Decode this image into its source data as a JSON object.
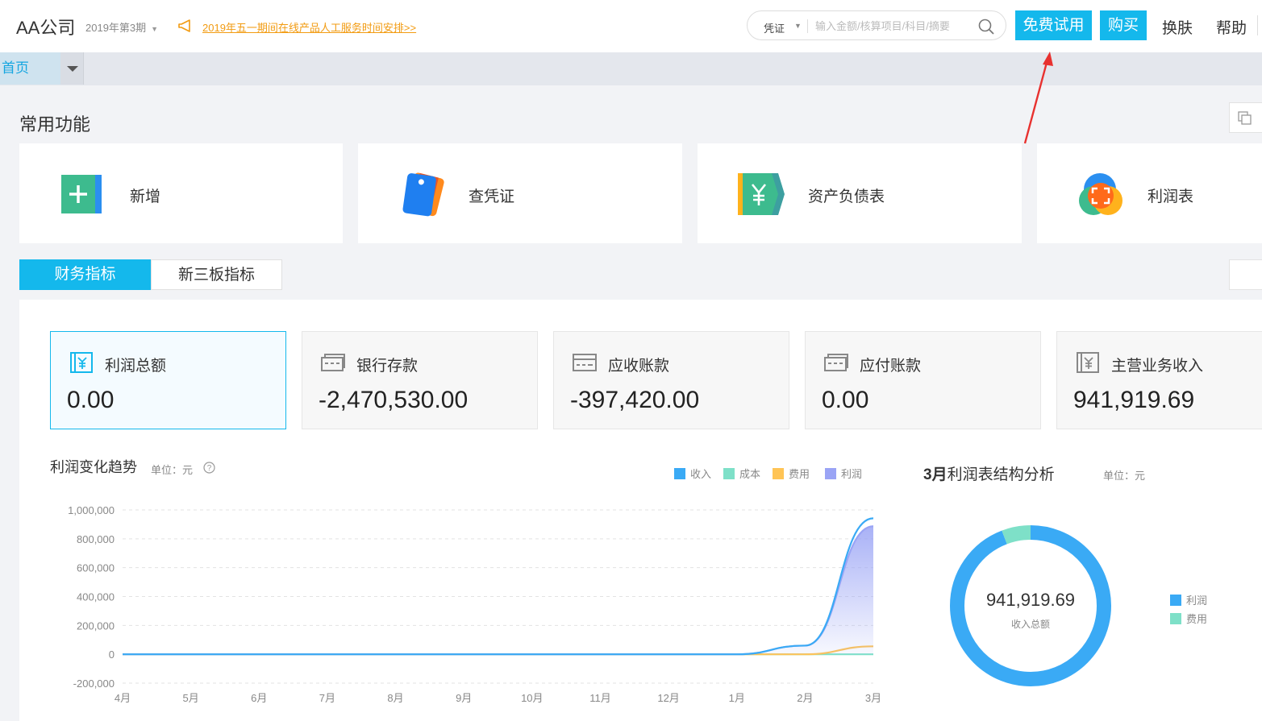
{
  "header": {
    "company": "AA公司",
    "period": "2019年第3期",
    "notice": "2019年五一期间在线产品人工服务时间安排>>",
    "search_type": "凭证",
    "search_placeholder": "输入金额/核算项目/科目/摘要",
    "trial_label": "免费试用",
    "buy_label": "购买",
    "skin_label": "换肤",
    "help_label": "帮助"
  },
  "tabs": {
    "home": "首页"
  },
  "common": {
    "title": "常用功能",
    "items": [
      {
        "label": "新增",
        "icon": "add-voucher-icon"
      },
      {
        "label": "查凭证",
        "icon": "voucher-tags-icon"
      },
      {
        "label": "资产负债表",
        "icon": "balance-sheet-icon"
      },
      {
        "label": "利润表",
        "icon": "profit-statement-icon"
      }
    ]
  },
  "indicator_tabs": [
    "财务指标",
    "新三板指标"
  ],
  "kpis": [
    {
      "label": "利润总额",
      "value": "0.00"
    },
    {
      "label": "银行存款",
      "value": "-2,470,530.00"
    },
    {
      "label": "应收账款",
      "value": "-397,420.00"
    },
    {
      "label": "应付账款",
      "value": "0.00"
    },
    {
      "label": "主营业务收入",
      "value": "941,919.69"
    }
  ],
  "trend": {
    "title": "利润变化趋势",
    "unit": "单位：元"
  },
  "analysis": {
    "title_bold": "3月",
    "title_rest": "利润表结构分析",
    "unit": "单位：元",
    "center_value": "941,919.69",
    "center_label": "收入总额",
    "legend": [
      {
        "name": "利润",
        "color": "#3aaaf5"
      },
      {
        "name": "费用",
        "color": "#7ee0c8"
      }
    ]
  },
  "colors": {
    "accent": "#14b8ec",
    "notice": "#f29b11"
  },
  "chart_data": [
    {
      "type": "area",
      "title": "",
      "x": [
        "4月",
        "5月",
        "6月",
        "7月",
        "8月",
        "9月",
        "10月",
        "11月",
        "12月",
        "1月",
        "2月",
        "3月"
      ],
      "yticks": [
        "1,000,000",
        "800,000",
        "600,000",
        "400,000",
        "200,000",
        "0",
        "-200,000"
      ],
      "ylim": [
        -200000,
        1000000
      ],
      "grid": true,
      "legend_position": "top-right",
      "series": [
        {
          "name": "收入",
          "color": "#3aaaf5",
          "values": [
            0,
            0,
            0,
            0,
            0,
            0,
            0,
            0,
            0,
            0,
            60000,
            941919.69
          ]
        },
        {
          "name": "成本",
          "color": "#7ee0c8",
          "values": [
            0,
            0,
            0,
            0,
            0,
            0,
            0,
            0,
            0,
            0,
            0,
            0
          ]
        },
        {
          "name": "费用",
          "color": "#ffc455",
          "values": [
            0,
            0,
            0,
            0,
            0,
            0,
            0,
            0,
            0,
            0,
            0,
            55000
          ]
        },
        {
          "name": "利润",
          "color": "#9aa4f5",
          "values": [
            0,
            0,
            0,
            0,
            0,
            0,
            0,
            0,
            0,
            0,
            60000,
            886919.69
          ]
        }
      ]
    },
    {
      "type": "pie",
      "title": "",
      "slices": [
        {
          "name": "利润",
          "value": 886919.69,
          "color": "#3aaaf5"
        },
        {
          "name": "费用",
          "value": 55000,
          "color": "#7ee0c8"
        }
      ]
    }
  ]
}
